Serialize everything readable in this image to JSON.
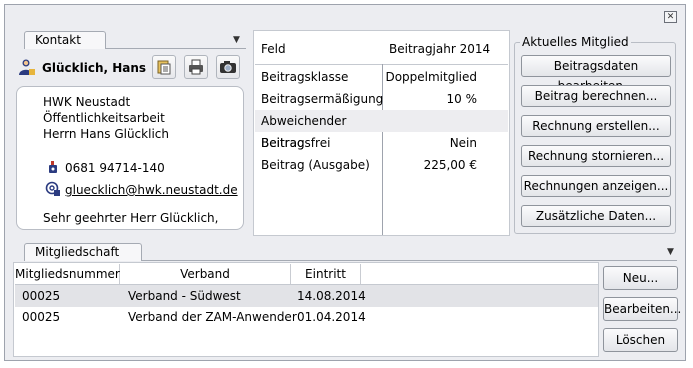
{
  "contact_tab": {
    "label": "Kontakt"
  },
  "contact": {
    "name": "Glücklich, Hans",
    "address_lines": [
      "HWK Neustadt",
      "Öffentlichkeitsarbeit",
      "Herrn Hans Glücklich"
    ],
    "phone": "0681 94714-140",
    "email": "gluecklich@hwk.neustadt.de",
    "salutation": "Sehr geehrter Herr Glücklich,"
  },
  "fee_table": {
    "col_feld": "Feld",
    "col_year": "Beitragjahr 2014",
    "rows": [
      {
        "label": "Beitragsklasse",
        "value": "Doppelmitglied"
      },
      {
        "label": "Beitragsermäßigung",
        "value": "10 %"
      },
      {
        "label": "Abweichender Beitrag",
        "value": ""
      },
      {
        "label": "Beitragsfrei",
        "value": "Nein"
      },
      {
        "label": "Beitrag (Ausgabe)",
        "value": "225,00 €"
      }
    ]
  },
  "current_member": {
    "title": "Aktuelles Mitglied",
    "buttons": [
      "Beitragsdaten bearbeiten...",
      "Beitrag berechnen...",
      "Rechnung erstellen...",
      "Rechnung stornieren...",
      "Rechnungen anzeigen...",
      "Zusätzliche Daten..."
    ]
  },
  "membership_tab": {
    "label": "Mitgliedschaft"
  },
  "membership": {
    "columns": [
      "Mitgliedsnummer",
      "Verband",
      "Eintritt"
    ],
    "rows": [
      {
        "nr": "00025",
        "verband": "Verband - Südwest",
        "eintritt": "14.08.2014"
      },
      {
        "nr": "00025",
        "verband": "Verband der ZAM-Anwender",
        "eintritt": "01.04.2014"
      }
    ],
    "buttons": {
      "new": "Neu...",
      "edit": "Bearbeiten...",
      "delete": "Löschen"
    }
  }
}
